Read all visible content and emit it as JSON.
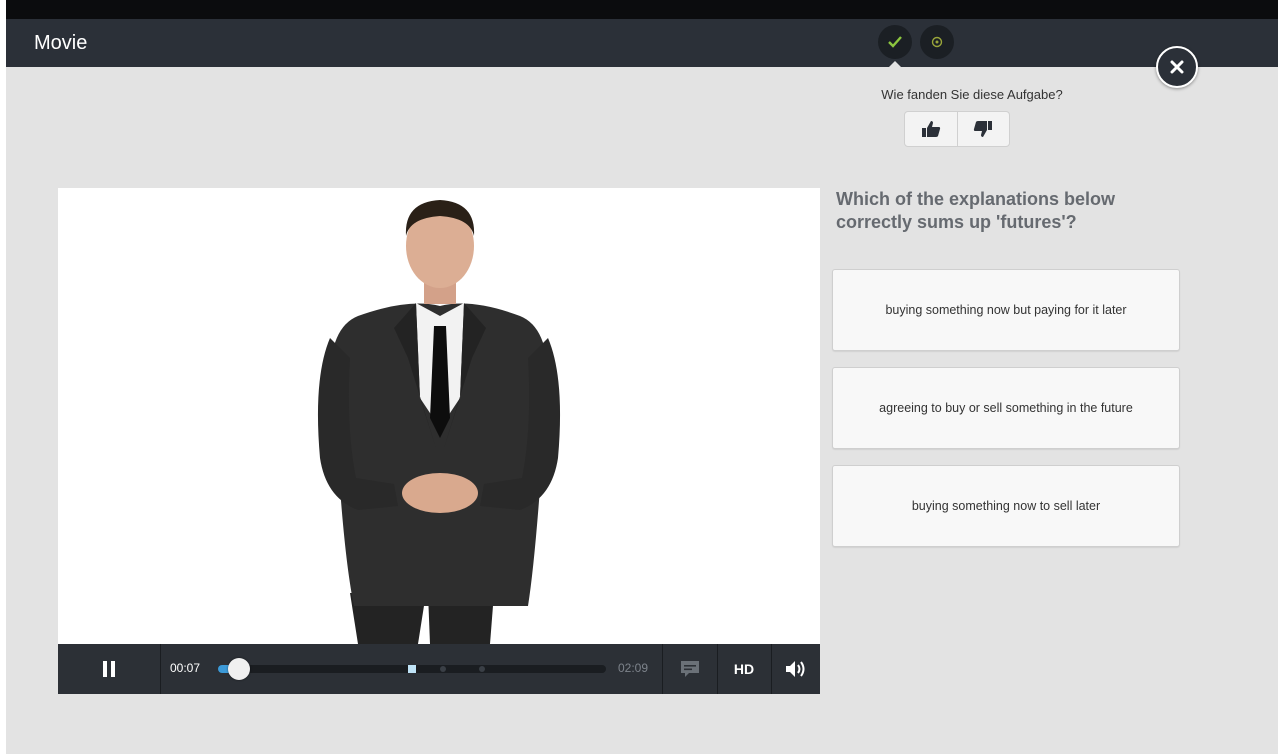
{
  "header": {
    "title": "Movie",
    "status_icons": [
      "check-icon",
      "target-icon"
    ]
  },
  "feedback": {
    "prompt": "Wie fanden Sie diese Aufgabe?",
    "icons": [
      "thumbs-up-icon",
      "thumbs-down-icon"
    ]
  },
  "player": {
    "current_time": "00:07",
    "total_time": "02:09",
    "progress_fraction": 0.055,
    "chapter_marks_fraction": [
      0.5,
      0.58,
      0.68
    ],
    "hd_label": "HD",
    "icons": [
      "pause-icon",
      "captions-icon",
      "volume-icon"
    ],
    "accent_color": "#3c9ad8"
  },
  "quiz": {
    "question": "Which of the explanations below correctly sums up 'futures'?",
    "answers": [
      "buying something now but paying for it later",
      "agreeing to buy or sell something in the future",
      "buying something now to sell later"
    ]
  },
  "colors": {
    "header_bg": "#2b3038",
    "page_bg": "#e3e3e3",
    "check_green": "#8cc63f",
    "target_olive": "#9aa63a"
  }
}
